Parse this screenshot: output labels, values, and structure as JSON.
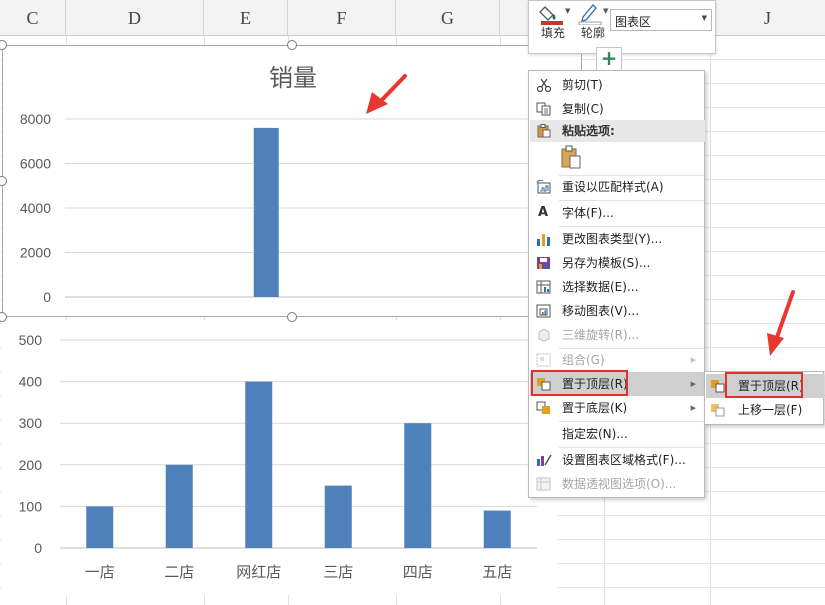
{
  "sheet": {
    "columns": [
      "C",
      "D",
      "E",
      "F",
      "G",
      "",
      "J"
    ]
  },
  "mini_toolbar": {
    "fill_label": "填充",
    "outline_label": "轮廓",
    "element_select_value": "图表区",
    "fill_color": "#c0392b"
  },
  "chart_elements_button": {
    "icon": "plus-icon",
    "label": "+"
  },
  "context_menu": {
    "items": [
      {
        "label": "剪切(T)",
        "icon": "scissors-icon",
        "disabled": false
      },
      {
        "label": "复制(C)",
        "icon": "copy-icon",
        "disabled": false
      },
      {
        "label": "粘贴选项:",
        "icon": "paste-icon",
        "disabled": false
      },
      {
        "label": "重设以匹配样式(A)",
        "icon": "reset-style-icon",
        "disabled": false
      },
      {
        "label": "字体(F)...",
        "icon": "font-icon",
        "disabled": false
      },
      {
        "label": "更改图表类型(Y)...",
        "icon": "chart-type-icon",
        "disabled": false
      },
      {
        "label": "另存为模板(S)...",
        "icon": "save-template-icon",
        "disabled": false
      },
      {
        "label": "选择数据(E)...",
        "icon": "select-data-icon",
        "disabled": false
      },
      {
        "label": "移动图表(V)...",
        "icon": "move-chart-icon",
        "disabled": false
      },
      {
        "label": "三维旋转(R)...",
        "icon": "rotate-3d-icon",
        "disabled": true
      },
      {
        "label": "组合(G)",
        "icon": "group-icon",
        "disabled": true
      },
      {
        "label": "置于顶层(R)",
        "icon": "bring-to-front-icon",
        "disabled": false
      },
      {
        "label": "置于底层(K)",
        "icon": "send-to-back-icon",
        "disabled": false
      },
      {
        "label": "指定宏(N)...",
        "icon": "",
        "disabled": false
      },
      {
        "label": "设置图表区域格式(F)...",
        "icon": "format-chart-area-icon",
        "disabled": false
      },
      {
        "label": "数据透视图选项(O)...",
        "icon": "pivot-chart-options-icon",
        "disabled": true
      }
    ]
  },
  "submenu": {
    "items": [
      {
        "label": "置于顶层(R)",
        "icon": "bring-to-front-icon"
      },
      {
        "label": "上移一层(F)",
        "icon": "bring-forward-icon"
      }
    ]
  },
  "colors": {
    "bar": "#4f81bd",
    "highlight_box": "#e0302a",
    "menu_hover": "#cfcfcf"
  },
  "chart_data": [
    {
      "type": "bar",
      "title": "销量",
      "categories": [],
      "values": [
        7600
      ],
      "ylim": [
        0,
        8000
      ],
      "yticks": [
        "8000",
        "6000",
        "4000",
        "2000",
        "0"
      ],
      "grid": true,
      "xlabel": "",
      "ylabel": ""
    },
    {
      "type": "bar",
      "title": "",
      "categories": [
        "一店",
        "二店",
        "网红店",
        "三店",
        "四店",
        "五店"
      ],
      "values": [
        100,
        200,
        400,
        150,
        300,
        90
      ],
      "ylim": [
        0,
        500
      ],
      "yticks": [
        "500",
        "400",
        "300",
        "200",
        "100",
        "0"
      ],
      "grid": true,
      "xlabel": "",
      "ylabel": ""
    }
  ]
}
